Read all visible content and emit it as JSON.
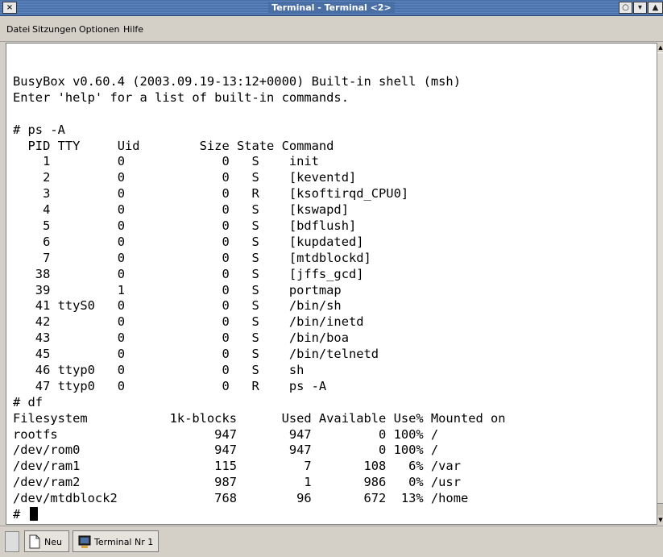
{
  "window": {
    "title": "Terminal - Terminal <2>",
    "close_symbol": "×",
    "menu_symbol": "▾",
    "restore_symbol": "○",
    "maximize_symbol": "▲"
  },
  "menu": {
    "items": [
      "Datei",
      "Sitzungen",
      "Optionen",
      "Hilfe"
    ]
  },
  "terminal": {
    "lines": [
      "BusyBox v0.60.4 (2003.09.19-13:12+0000) Built-in shell (msh)",
      "Enter 'help' for a list of built-in commands.",
      "",
      "# ps -A",
      "  PID TTY     Uid        Size State Command",
      "    1         0             0   S    init",
      "    2         0             0   S    [keventd]",
      "    3         0             0   R    [ksoftirqd_CPU0]",
      "    4         0             0   S    [kswapd]",
      "    5         0             0   S    [bdflush]",
      "    6         0             0   S    [kupdated]",
      "    7         0             0   S    [mtdblockd]",
      "   38         0             0   S    [jffs_gcd]",
      "   39         1             0   S    portmap",
      "   41 ttyS0   0             0   S    /bin/sh",
      "   42         0             0   S    /bin/inetd",
      "   43         0             0   S    /bin/boa",
      "   45         0             0   S    /bin/telnetd",
      "   46 ttyp0   0             0   S    sh",
      "   47 ttyp0   0             0   R    ps -A",
      "# df",
      "Filesystem           1k-blocks      Used Available Use% Mounted on",
      "rootfs                     947       947         0 100% /",
      "/dev/rom0                  947       947         0 100% /",
      "/dev/ram1                  115         7       108   6% /var",
      "/dev/ram2                  987         1       986   0% /usr",
      "/dev/mtdblock2             768        96       672  13% /home",
      "# "
    ]
  },
  "scrollbar": {
    "up_symbol": "▲",
    "down_symbol": "▼"
  },
  "taskbar": {
    "new_label": "Neu",
    "terminal_label": "Terminal Nr 1"
  }
}
